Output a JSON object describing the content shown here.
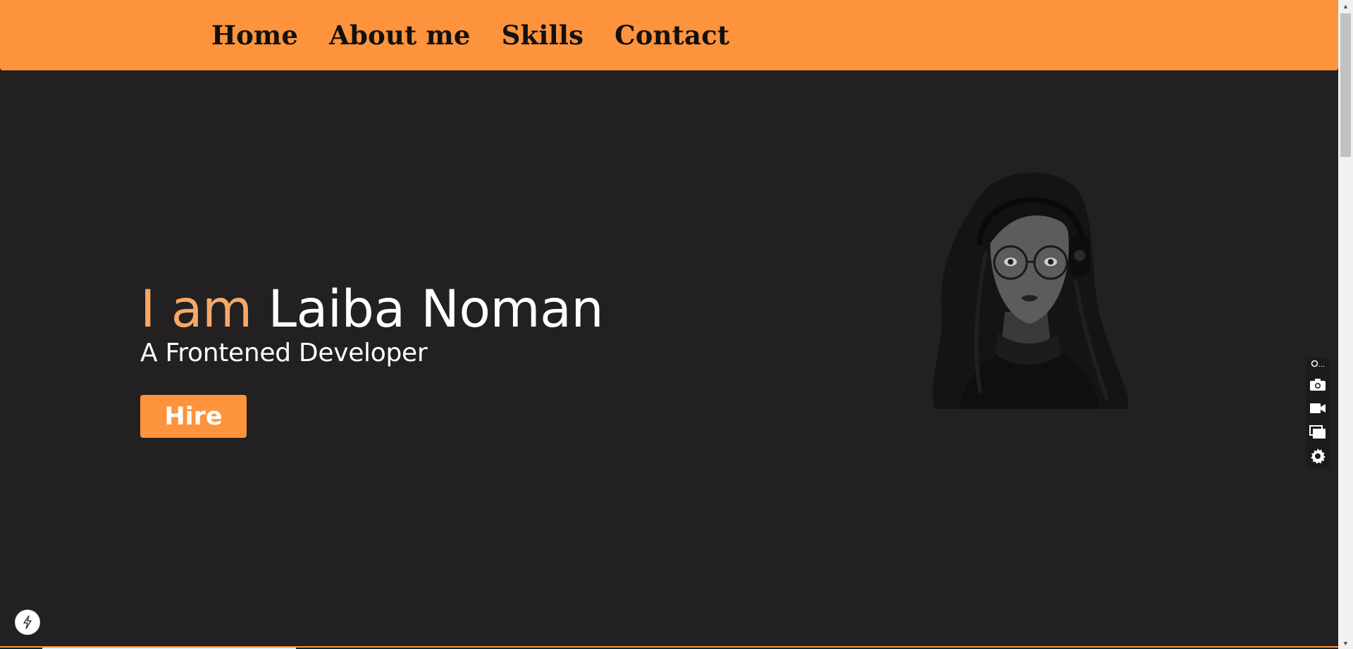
{
  "nav": {
    "items": [
      {
        "label": "Home"
      },
      {
        "label": "About me"
      },
      {
        "label": "Skills"
      },
      {
        "label": "Contact"
      }
    ]
  },
  "hero": {
    "title_prefix": "I am",
    "title_name": "Laiba Noman",
    "subtitle": "A Frontened Developer",
    "hire_label": "Hire"
  },
  "toolbar": {
    "top_label": "...",
    "icons": [
      "link-icon",
      "camera-icon",
      "video-camera-icon",
      "window-icon",
      "gear-icon"
    ]
  },
  "icons": {
    "avatar": "avatar-illustration",
    "bolt": "lightning-bolt-icon"
  },
  "colors": {
    "accent": "#fd933c",
    "accent_light": "#f7a866",
    "background": "#222021",
    "text": "#ffffff"
  }
}
